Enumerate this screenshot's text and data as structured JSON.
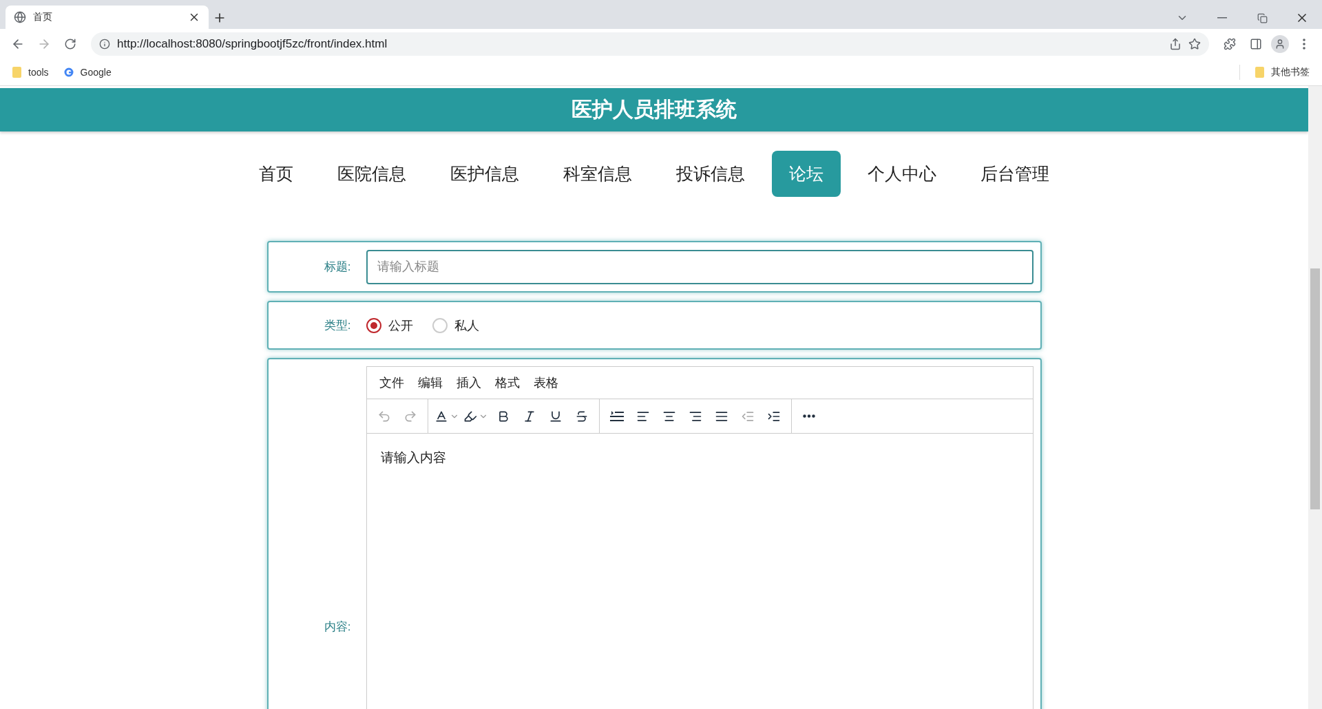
{
  "browser": {
    "tab": {
      "title": "首页"
    },
    "url": "http://localhost:8080/springbootjf5zc/front/index.html",
    "bookmarks": [
      {
        "kind": "folder",
        "label": "tools"
      },
      {
        "kind": "google",
        "label": "Google"
      }
    ],
    "other_bookmarks": "其他书签"
  },
  "header": {
    "title": "医护人员排班系统"
  },
  "nav": [
    {
      "label": "首页",
      "selected": false
    },
    {
      "label": "医院信息",
      "selected": false
    },
    {
      "label": "医护信息",
      "selected": false
    },
    {
      "label": "科室信息",
      "selected": false
    },
    {
      "label": "投诉信息",
      "selected": false
    },
    {
      "label": "论坛",
      "selected": true
    },
    {
      "label": "个人中心",
      "selected": false
    },
    {
      "label": "后台管理",
      "selected": false
    }
  ],
  "form": {
    "title_field": {
      "label": "标题:",
      "placeholder": "请输入标题"
    },
    "type_field": {
      "label": "类型:",
      "options": [
        {
          "label": "公开",
          "selected": true
        },
        {
          "label": "私人",
          "selected": false
        }
      ]
    },
    "content_field": {
      "label": "内容:",
      "menu": [
        "文件",
        "编辑",
        "插入",
        "格式",
        "表格"
      ],
      "placeholder": "请输入内容",
      "toolbar": [
        [
          {
            "kind": "undo",
            "disabled": true
          },
          {
            "kind": "redo",
            "disabled": true
          }
        ],
        [
          {
            "kind": "text-color",
            "disabled": false
          },
          {
            "kind": "highlight",
            "disabled": false
          },
          {
            "kind": "bold",
            "disabled": false
          },
          {
            "kind": "italic",
            "disabled": false
          },
          {
            "kind": "underline",
            "disabled": false
          },
          {
            "kind": "strike",
            "disabled": false
          }
        ],
        [
          {
            "kind": "line-height",
            "disabled": false
          },
          {
            "kind": "align-left",
            "disabled": false
          },
          {
            "kind": "align-center",
            "disabled": false
          },
          {
            "kind": "align-right",
            "disabled": false
          },
          {
            "kind": "justify",
            "disabled": false
          },
          {
            "kind": "outdent",
            "disabled": true
          },
          {
            "kind": "indent",
            "disabled": false
          }
        ],
        [
          {
            "kind": "more",
            "disabled": false
          }
        ]
      ]
    }
  }
}
